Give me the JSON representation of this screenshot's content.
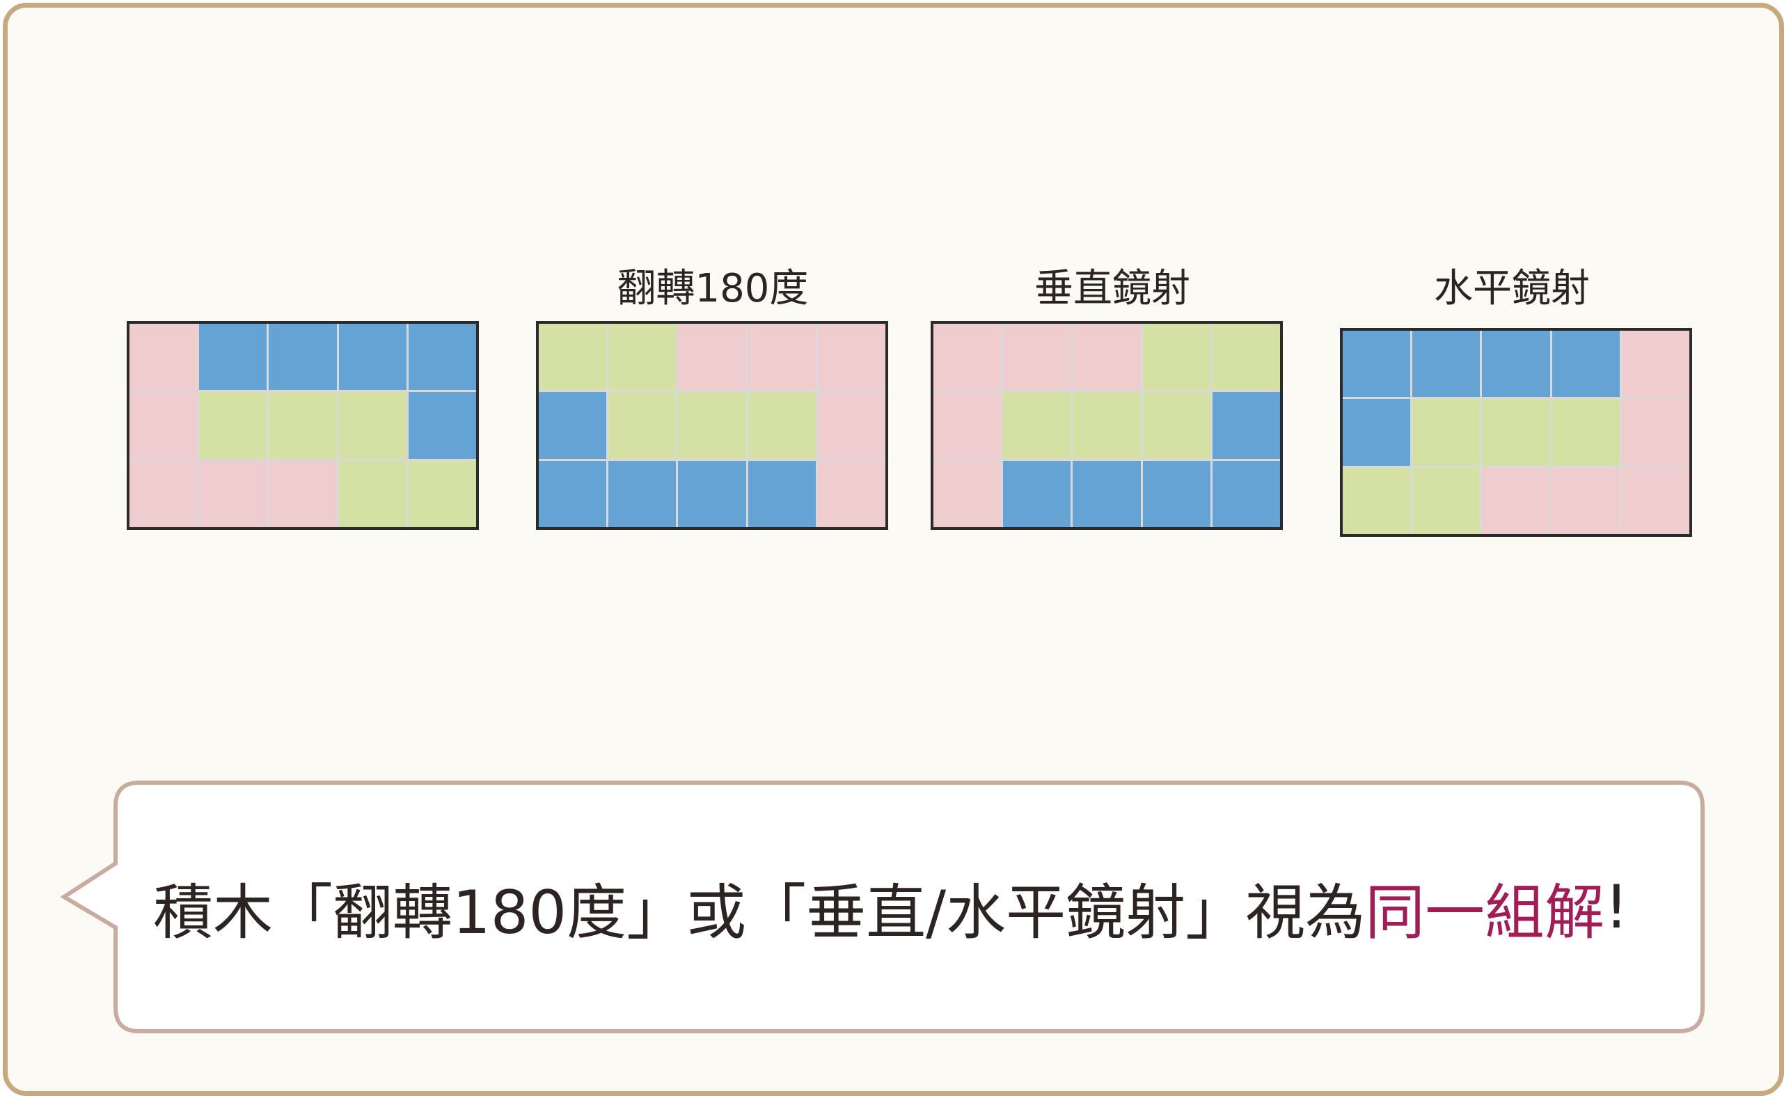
{
  "colors": {
    "pink": "#efcdcf",
    "blue": "#65a3d4",
    "green": "#d4e0a4",
    "highlight": "#a11d55"
  },
  "grids": [
    {
      "title": "",
      "cells": [
        [
          "pink",
          "blue",
          "blue",
          "blue",
          "blue"
        ],
        [
          "pink",
          "green",
          "green",
          "green",
          "blue"
        ],
        [
          "pink",
          "pink",
          "pink",
          "green",
          "green"
        ]
      ]
    },
    {
      "title": "翻轉180度",
      "cells": [
        [
          "green",
          "green",
          "pink",
          "pink",
          "pink"
        ],
        [
          "blue",
          "green",
          "green",
          "green",
          "pink"
        ],
        [
          "blue",
          "blue",
          "blue",
          "blue",
          "pink"
        ]
      ]
    },
    {
      "title": "垂直鏡射",
      "cells": [
        [
          "pink",
          "pink",
          "pink",
          "green",
          "green"
        ],
        [
          "pink",
          "green",
          "green",
          "green",
          "blue"
        ],
        [
          "pink",
          "blue",
          "blue",
          "blue",
          "blue"
        ]
      ]
    },
    {
      "title": "水平鏡射",
      "cells": [
        [
          "blue",
          "blue",
          "blue",
          "blue",
          "pink"
        ],
        [
          "blue",
          "green",
          "green",
          "green",
          "pink"
        ],
        [
          "green",
          "green",
          "pink",
          "pink",
          "pink"
        ]
      ]
    }
  ],
  "caption": {
    "text_before": "積木「翻轉180度」或「垂直/水平鏡射」視為",
    "text_highlight": "同一組解",
    "text_after": "!"
  }
}
